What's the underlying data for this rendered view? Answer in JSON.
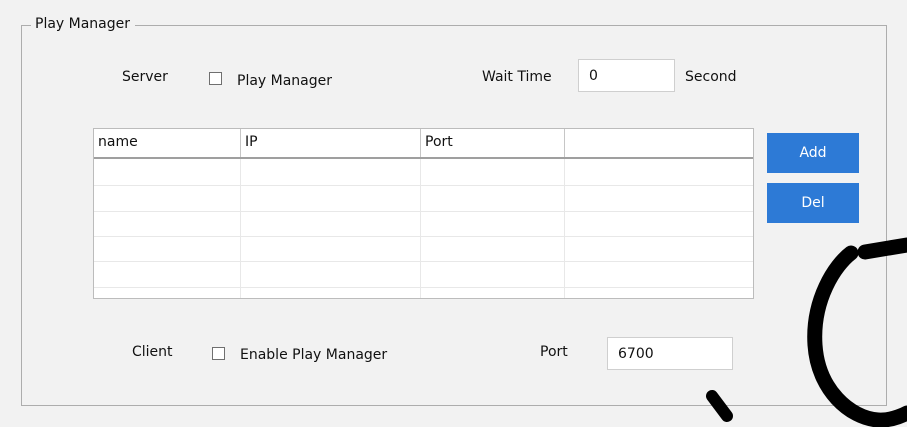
{
  "group": {
    "title": "Play Manager"
  },
  "server": {
    "label": "Server",
    "checkbox_label": "Play Manager",
    "checked": false,
    "wait_time_label": "Wait Time",
    "wait_time_value": "0",
    "wait_time_unit": "Second"
  },
  "table": {
    "columns": [
      "name",
      "IP",
      "Port",
      ""
    ],
    "rows": [
      [
        "",
        "",
        "",
        ""
      ],
      [
        "",
        "",
        "",
        ""
      ],
      [
        "",
        "",
        "",
        ""
      ],
      [
        "",
        "",
        "",
        ""
      ],
      [
        "",
        "",
        "",
        ""
      ]
    ]
  },
  "buttons": {
    "add_label": "Add",
    "del_label": "Del"
  },
  "client": {
    "label": "Client",
    "checkbox_label": "Enable Play Manager",
    "checked": false,
    "port_label": "Port",
    "port_value": "6700"
  },
  "colors": {
    "button_bg": "#2d7ad6",
    "panel_bg": "#f2f2f2",
    "watermark": "#000000"
  }
}
